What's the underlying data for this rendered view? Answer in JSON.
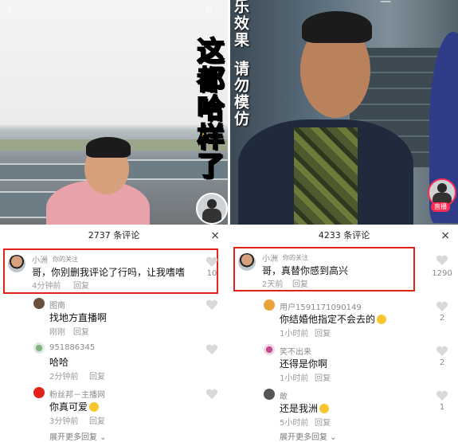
{
  "left": {
    "overlay_text": "这都哈样了",
    "comments_header": "2737 条评论",
    "close_symbol": "×",
    "highlighted": {
      "user": "小洲",
      "follow_tag": "你的关注",
      "text": "哥，你别删我评论了行吗，让我嗜嗜",
      "time": "4分钟前",
      "reply": "回复",
      "likes": "10"
    },
    "comments": [
      {
        "user": "图南",
        "text": "找地方直播啊",
        "time": "刚刚",
        "reply": "回复"
      },
      {
        "user": "951886345",
        "text": "哈哈",
        "time": "2分钟前",
        "reply": "回复"
      },
      {
        "user": "粉丝邦－主播网",
        "text": "你真可爱",
        "time": "3分钟前",
        "reply": "回复"
      }
    ],
    "expand": "展开更多回复"
  },
  "right": {
    "overlay_top": "乐效果",
    "overlay_warning": "请勿模仿",
    "live_tag": "直播",
    "comments_header": "4233 条评论",
    "close_symbol": "×",
    "highlighted": {
      "user": "小洲",
      "follow_tag": "你的关注",
      "text": "哥，真替你感到高兴",
      "time": "2天前",
      "reply": "回复",
      "likes": "1290"
    },
    "comments": [
      {
        "user": "用户1591171090149",
        "text": "你结婚他指定不会去的",
        "time": "1小时前",
        "reply": "回复",
        "likes": "2"
      },
      {
        "user": "笑不出来",
        "text": "还得是你啊",
        "time": "1小时前",
        "reply": "回复",
        "likes": "2"
      },
      {
        "user": "敢",
        "text": "还是我洲",
        "time": "5小时前",
        "reply": "回复",
        "likes": "1"
      }
    ],
    "expand": "展开更多回复"
  },
  "colors": {
    "highlight": "#e2231a",
    "overlay_yellow": "#ffd400",
    "live": "#fe2c55"
  }
}
